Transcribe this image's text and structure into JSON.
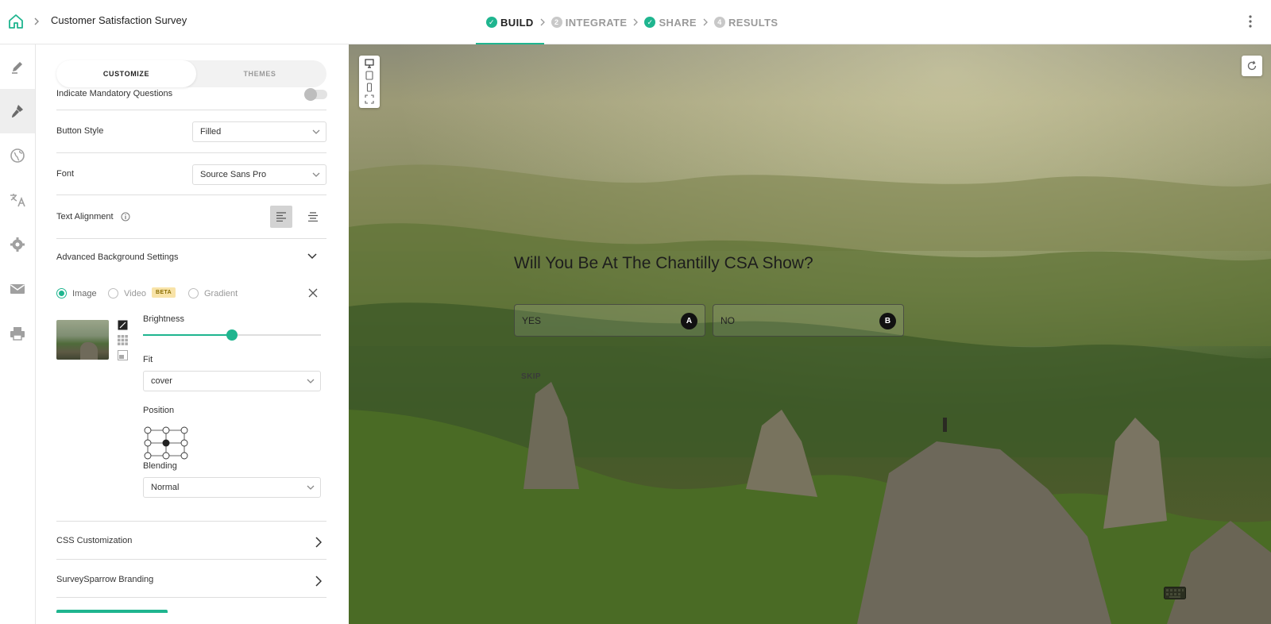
{
  "header": {
    "survey_title": "Customer Satisfaction Survey",
    "steps": [
      {
        "label": "BUILD",
        "state": "done",
        "badge": "✓"
      },
      {
        "label": "INTEGRATE",
        "state": "pending",
        "badge": "2"
      },
      {
        "label": "SHARE",
        "state": "done",
        "badge": "✓"
      },
      {
        "label": "RESULTS",
        "state": "pending",
        "badge": "4"
      }
    ]
  },
  "rail": [
    "edit-icon",
    "paintbrush-icon",
    "globe-icon",
    "translate-icon",
    "gear-icon",
    "mail-icon",
    "print-icon"
  ],
  "panel": {
    "tabs": {
      "customize": "CUSTOMIZE",
      "themes": "THEMES"
    },
    "mandatory_label": "Indicate Mandatory Questions",
    "button_style_label": "Button Style",
    "button_style_value": "Filled",
    "font_label": "Font",
    "font_value": "Source Sans Pro",
    "text_alignment_label": "Text Alignment",
    "advanced_bg_label": "Advanced Background Settings",
    "bg_types": {
      "image": "Image",
      "video": "Video",
      "beta": "BETA",
      "gradient": "Gradient"
    },
    "brightness_label": "Brightness",
    "brightness_value": 0.5,
    "fit_label": "Fit",
    "fit_value": "cover",
    "position_label": "Position",
    "blending_label": "Blending",
    "blending_value": "Normal",
    "css_label": "CSS Customization",
    "branding_label": "SurveySparrow Branding"
  },
  "preview": {
    "question": "Will You Be At The Chantilly CSA Show?",
    "answers": [
      {
        "label": "YES",
        "key": "A"
      },
      {
        "label": "NO",
        "key": "B"
      }
    ],
    "skip": "SKIP"
  },
  "colors": {
    "accent": "#1fb58f"
  }
}
